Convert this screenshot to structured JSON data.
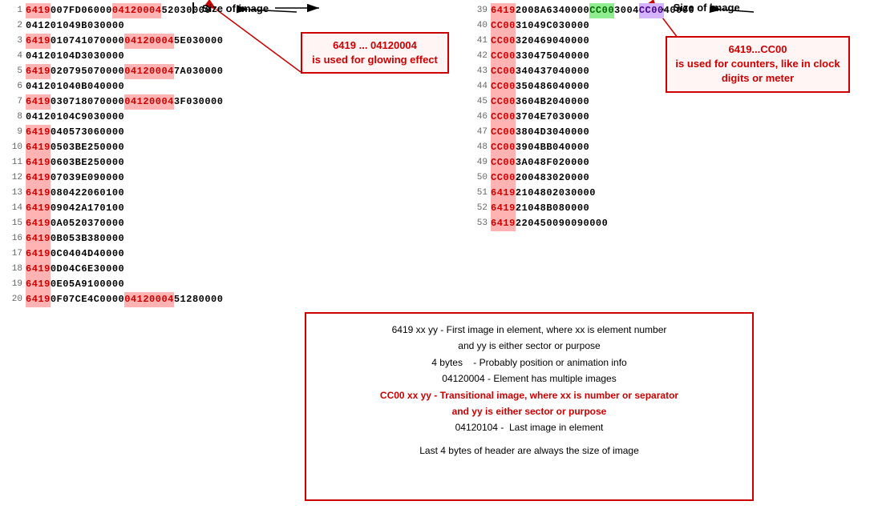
{
  "left_rows": [
    {
      "num": 1,
      "parts": [
        {
          "text": "6419",
          "style": "pink"
        },
        {
          "text": "007FD06000",
          "style": "normal"
        },
        {
          "text": "04120004",
          "style": "pink"
        },
        {
          "text": "52030000",
          "style": "normal"
        }
      ]
    },
    {
      "num": 2,
      "parts": [
        {
          "text": "04120104",
          "style": "normal"
        },
        {
          "text": "9B030000",
          "style": "normal"
        }
      ]
    },
    {
      "num": 3,
      "parts": [
        {
          "text": "6419",
          "style": "pink"
        },
        {
          "text": "010741070000",
          "style": "normal"
        },
        {
          "text": "04120004",
          "style": "pink"
        },
        {
          "text": "5E030000",
          "style": "normal"
        }
      ]
    },
    {
      "num": 4,
      "parts": [
        {
          "text": "04120104",
          "style": "normal"
        },
        {
          "text": "D3030000",
          "style": "normal"
        }
      ]
    },
    {
      "num": 5,
      "parts": [
        {
          "text": "6419",
          "style": "pink"
        },
        {
          "text": "020795070000",
          "style": "normal"
        },
        {
          "text": "04120004",
          "style": "pink"
        },
        {
          "text": "7A030000",
          "style": "normal"
        }
      ]
    },
    {
      "num": 6,
      "parts": [
        {
          "text": "04120104",
          "style": "normal"
        },
        {
          "text": "0B040000",
          "style": "normal"
        }
      ]
    },
    {
      "num": 7,
      "parts": [
        {
          "text": "6419",
          "style": "pink"
        },
        {
          "text": "030718070000",
          "style": "normal"
        },
        {
          "text": "04120004",
          "style": "pink"
        },
        {
          "text": "3F030000",
          "style": "normal"
        }
      ]
    },
    {
      "num": 8,
      "parts": [
        {
          "text": "04120104",
          "style": "normal"
        },
        {
          "text": "C9030000",
          "style": "normal"
        }
      ]
    },
    {
      "num": 9,
      "parts": [
        {
          "text": "6419",
          "style": "pink"
        },
        {
          "text": "040573060000",
          "style": "normal"
        }
      ]
    },
    {
      "num": 10,
      "parts": [
        {
          "text": "6419",
          "style": "pink"
        },
        {
          "text": "0503BE250000",
          "style": "normal"
        }
      ]
    },
    {
      "num": 11,
      "parts": [
        {
          "text": "6419",
          "style": "pink"
        },
        {
          "text": "0603BE250000",
          "style": "normal"
        }
      ]
    },
    {
      "num": 12,
      "parts": [
        {
          "text": "6419",
          "style": "pink"
        },
        {
          "text": "07039E090000",
          "style": "normal"
        }
      ]
    },
    {
      "num": 13,
      "parts": [
        {
          "text": "6419",
          "style": "pink"
        },
        {
          "text": "080422060100",
          "style": "normal"
        }
      ]
    },
    {
      "num": 14,
      "parts": [
        {
          "text": "6419",
          "style": "pink"
        },
        {
          "text": "09042A170100",
          "style": "normal"
        }
      ]
    },
    {
      "num": 15,
      "parts": [
        {
          "text": "6419",
          "style": "pink"
        },
        {
          "text": "0A0520370000",
          "style": "normal"
        }
      ]
    },
    {
      "num": 16,
      "parts": [
        {
          "text": "6419",
          "style": "pink"
        },
        {
          "text": "0B053B380000",
          "style": "normal"
        }
      ]
    },
    {
      "num": 17,
      "parts": [
        {
          "text": "6419",
          "style": "pink"
        },
        {
          "text": "0C0404D40000",
          "style": "normal"
        }
      ]
    },
    {
      "num": 18,
      "parts": [
        {
          "text": "6419",
          "style": "pink"
        },
        {
          "text": "0D04C6E30000",
          "style": "normal"
        }
      ]
    },
    {
      "num": 19,
      "parts": [
        {
          "text": "6419",
          "style": "pink"
        },
        {
          "text": "0E05A9100000",
          "style": "normal"
        }
      ]
    },
    {
      "num": 20,
      "parts": [
        {
          "text": "6419",
          "style": "pink"
        },
        {
          "text": "0F07CE4C0000",
          "style": "normal"
        },
        {
          "text": "04120004",
          "style": "pink"
        },
        {
          "text": "51280000",
          "style": "normal"
        }
      ]
    }
  ],
  "right_rows": [
    {
      "num": 39,
      "parts": [
        {
          "text": "6419",
          "style": "pink"
        },
        {
          "text": "2008A6340000",
          "style": "normal"
        },
        {
          "text": "CC00",
          "style": "green"
        },
        {
          "text": "3004",
          "style": "normal"
        },
        {
          "text": "CC00",
          "style": "purple"
        },
        {
          "text": "40000",
          "style": "normal"
        }
      ]
    },
    {
      "num": 40,
      "parts": [
        {
          "text": "CC00",
          "style": "pink"
        },
        {
          "text": "3104",
          "style": "normal"
        },
        {
          "text": "9C030000",
          "style": "normal"
        }
      ]
    },
    {
      "num": 41,
      "parts": [
        {
          "text": "CC00",
          "style": "pink"
        },
        {
          "text": "3204",
          "style": "normal"
        },
        {
          "text": "69040000",
          "style": "normal"
        }
      ]
    },
    {
      "num": 42,
      "parts": [
        {
          "text": "CC00",
          "style": "pink"
        },
        {
          "text": "3304",
          "style": "normal"
        },
        {
          "text": "75040000",
          "style": "normal"
        }
      ]
    },
    {
      "num": 43,
      "parts": [
        {
          "text": "CC00",
          "style": "pink"
        },
        {
          "text": "3404",
          "style": "normal"
        },
        {
          "text": "37040000",
          "style": "normal"
        }
      ]
    },
    {
      "num": 44,
      "parts": [
        {
          "text": "CC00",
          "style": "pink"
        },
        {
          "text": "3504",
          "style": "normal"
        },
        {
          "text": "86040000",
          "style": "normal"
        }
      ]
    },
    {
      "num": 45,
      "parts": [
        {
          "text": "CC00",
          "style": "pink"
        },
        {
          "text": "3604",
          "style": "normal"
        },
        {
          "text": "B2040000",
          "style": "normal"
        }
      ]
    },
    {
      "num": 46,
      "parts": [
        {
          "text": "CC00",
          "style": "pink"
        },
        {
          "text": "3704",
          "style": "normal"
        },
        {
          "text": "E7030000",
          "style": "normal"
        }
      ]
    },
    {
      "num": 47,
      "parts": [
        {
          "text": "CC00",
          "style": "pink"
        },
        {
          "text": "3804",
          "style": "normal"
        },
        {
          "text": "D3040000",
          "style": "normal"
        }
      ]
    },
    {
      "num": 48,
      "parts": [
        {
          "text": "CC00",
          "style": "pink"
        },
        {
          "text": "3904",
          "style": "normal"
        },
        {
          "text": "BB040000",
          "style": "normal"
        }
      ]
    },
    {
      "num": 49,
      "parts": [
        {
          "text": "CC00",
          "style": "pink"
        },
        {
          "text": "3A04",
          "style": "normal"
        },
        {
          "text": "8F020000",
          "style": "normal"
        }
      ]
    },
    {
      "num": 50,
      "parts": [
        {
          "text": "CC00",
          "style": "pink"
        },
        {
          "text": "2004",
          "style": "normal"
        },
        {
          "text": "83020000",
          "style": "normal"
        }
      ]
    },
    {
      "num": 51,
      "parts": [
        {
          "text": "6419",
          "style": "pink"
        },
        {
          "text": "21048",
          "style": "normal"
        },
        {
          "text": "02030000",
          "style": "normal"
        }
      ]
    },
    {
      "num": 52,
      "parts": [
        {
          "text": "6419",
          "style": "pink"
        },
        {
          "text": "21048B080000",
          "style": "normal"
        }
      ]
    },
    {
      "num": 53,
      "parts": [
        {
          "text": "6419",
          "style": "pink"
        },
        {
          "text": "22045009",
          "style": "normal"
        },
        {
          "text": "0090000",
          "style": "normal"
        }
      ]
    }
  ],
  "annotations": {
    "left_size_label": "Size of image",
    "right_size_label": "Size of image",
    "glow_title": "6419 ... 04120004",
    "glow_desc": "is used for glowing effect",
    "counter_title": "6419...CC00",
    "counter_desc": "is used for counters, like in clock digits or meter"
  },
  "info_box": {
    "line1": "6419 xx yy - First image in element, where xx is element number",
    "line2": "and yy is either sector or purpose",
    "line3": "4 bytes    - Probably position or animation info",
    "line4": "04120004 - Element has multiple images",
    "line5": "CC00 xx yy - Transitional image, where xx is number or separator",
    "line6": "and yy is either sector or purpose",
    "line7": "04120104 -  Last image in element",
    "line8": "",
    "line9": "Last 4 bytes of header are always the size of image"
  }
}
